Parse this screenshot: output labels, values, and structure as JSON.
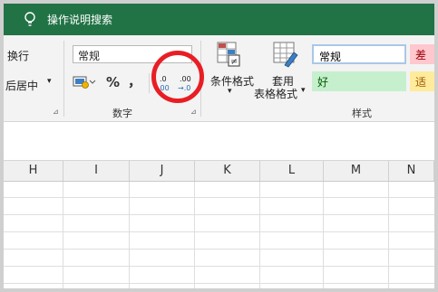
{
  "search": {
    "text": "操作说明搜索"
  },
  "alignment": {
    "wrap_label": "换行",
    "merge_label": "后居中"
  },
  "number": {
    "format_value": "常规",
    "percent_symbol": "%",
    "comma_symbol": "，",
    "increase_decimal_top": ".0",
    "increase_decimal_bottom": ".00",
    "decrease_decimal_top": ".00",
    "decrease_decimal_bottom": "→.0",
    "group_label": "数字"
  },
  "styles": {
    "conditional_label": "条件格式",
    "table_format_line1": "套用",
    "table_format_line2": "表格格式",
    "cell_normal": "常规",
    "cell_bad": "差",
    "cell_good": "好",
    "cell_neutral": "适中",
    "group_label": "样式"
  },
  "columns": [
    "H",
    "I",
    "J",
    "K",
    "L",
    "M",
    "N"
  ],
  "colors": {
    "accent": "#217346",
    "highlight_circle": "#e81e25",
    "bad_bg": "#ffc7ce",
    "good_bg": "#c6efce",
    "neutral_bg": "#ffeb9c"
  }
}
